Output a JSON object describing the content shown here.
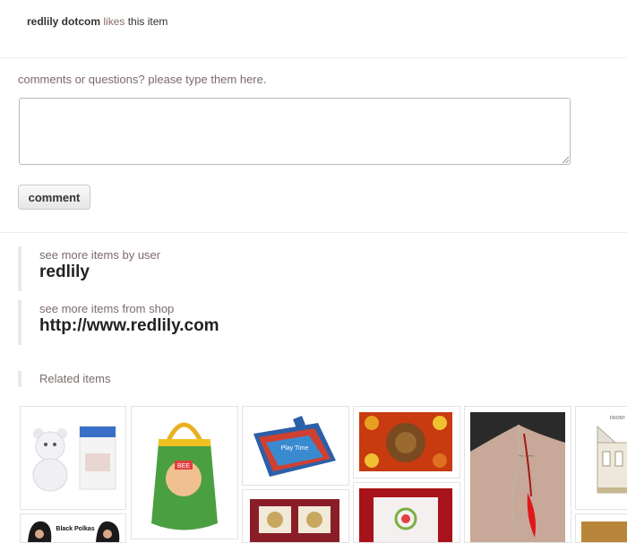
{
  "activity": {
    "user": "redlily dotcom",
    "verb": "likes",
    "object": "this item"
  },
  "comment": {
    "prompt": "comments or questions? please type them here.",
    "value": "",
    "button_label": "comment"
  },
  "more_by_user": {
    "label": "see more items by user",
    "value": "redlily"
  },
  "more_from_shop": {
    "label": "see more items from shop",
    "value": "http://www.redlily.com"
  },
  "related": {
    "title": "Related items",
    "items": [
      {
        "name": "teddy-bear-gift-item"
      },
      {
        "name": "cartoon-drawstring-bag-item",
        "caption": "BEE"
      },
      {
        "name": "play-mat-item",
        "caption": "Play Time"
      },
      {
        "name": "spice-platter-item"
      },
      {
        "name": "back-tattoo-red-feather-item"
      },
      {
        "name": "temple-drawing-item",
        "caption": "FRONT"
      },
      {
        "name": "black-polkas-item",
        "caption": "Black Polkas"
      },
      {
        "name": "gift-box-item"
      },
      {
        "name": "embroidered-cushion-item"
      }
    ]
  }
}
